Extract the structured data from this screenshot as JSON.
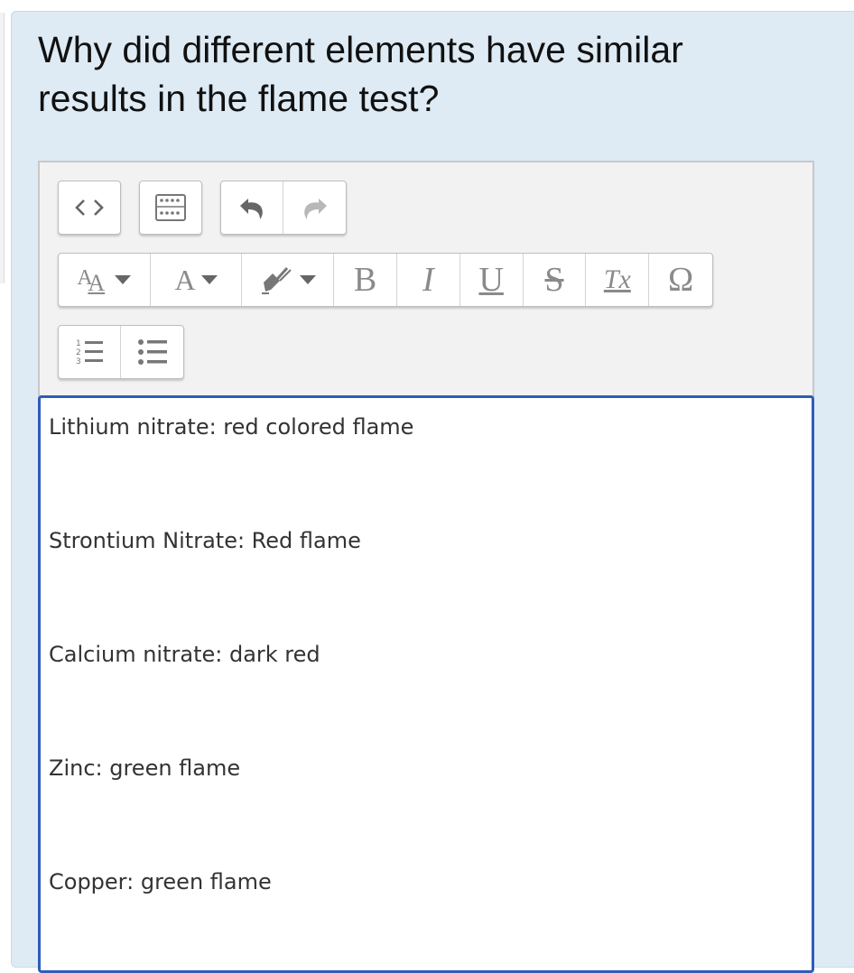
{
  "question": {
    "text": "Why did different elements have similar results in the flame test?"
  },
  "toolbar": {
    "font_size_label": "A",
    "font_color_label": "A",
    "bold_label": "B",
    "italic_label": "I",
    "underline_label": "U",
    "strike_label": "S",
    "clear_format_label": "Tx",
    "special_char_label": "Ω",
    "icons": [
      "code-view-icon",
      "keyboard-icon",
      "undo-icon",
      "redo-icon",
      "font-size-icon",
      "font-color-icon",
      "highlight-icon",
      "bold-icon",
      "italic-icon",
      "underline-icon",
      "strikethrough-icon",
      "clear-format-icon",
      "omega-icon",
      "numbered-list-icon",
      "bulleted-list-icon"
    ]
  },
  "editor": {
    "lines": [
      "Lithium nitrate: red colored flame",
      "Strontium Nitrate: Red flame",
      "Calcium nitrate: dark red",
      "Zinc: green flame",
      "Copper: green flame"
    ]
  },
  "colors": {
    "panel_bg": "#deebf5",
    "focus_border": "#2f5db8",
    "toolbar_bg": "#f2f2f2"
  }
}
